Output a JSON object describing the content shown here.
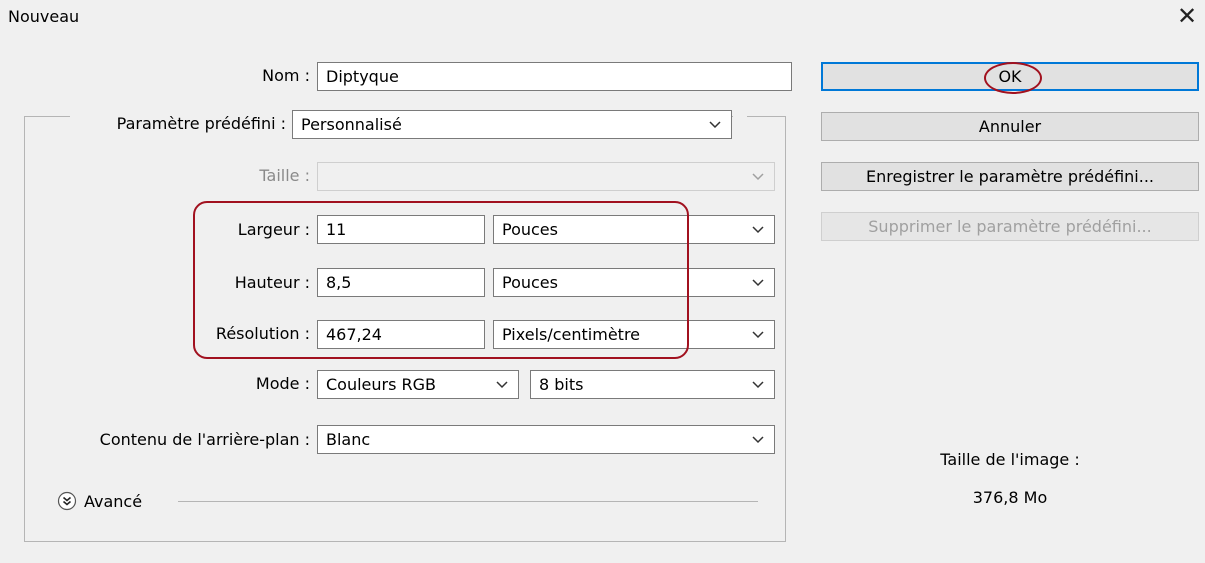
{
  "dialog": {
    "title": "Nouveau"
  },
  "form": {
    "name_label": "Nom :",
    "name_value": "Diptyque",
    "preset_label": "Paramètre prédéfini :",
    "preset_value": "Personnalisé",
    "size_label": "Taille :",
    "size_value": "",
    "width_label": "Largeur :",
    "width_value": "11",
    "width_unit": "Pouces",
    "height_label": "Hauteur :",
    "height_value": "8,5",
    "height_unit": "Pouces",
    "resolution_label": "Résolution :",
    "resolution_value": "467,24",
    "resolution_unit": "Pixels/centimètre",
    "mode_label": "Mode :",
    "mode_value": "Couleurs RGB",
    "bit_depth": "8 bits",
    "background_label": "Contenu de l'arrière-plan :",
    "background_value": "Blanc",
    "advanced_label": "Avancé"
  },
  "buttons": {
    "ok": "OK",
    "cancel": "Annuler",
    "save_preset": "Enregistrer le paramètre prédéfini...",
    "delete_preset": "Supprimer le paramètre prédéfini..."
  },
  "image_info": {
    "label": "Taille de l'image :",
    "value": "376,8 Mo"
  },
  "icons": {
    "close": "close-icon",
    "dropdown": "chevron-down-icon",
    "advanced": "double-chevron-down-icon"
  },
  "colors": {
    "annotation": "#a1111f",
    "primary_border": "#0078d7",
    "background": "#f0f0f0"
  }
}
